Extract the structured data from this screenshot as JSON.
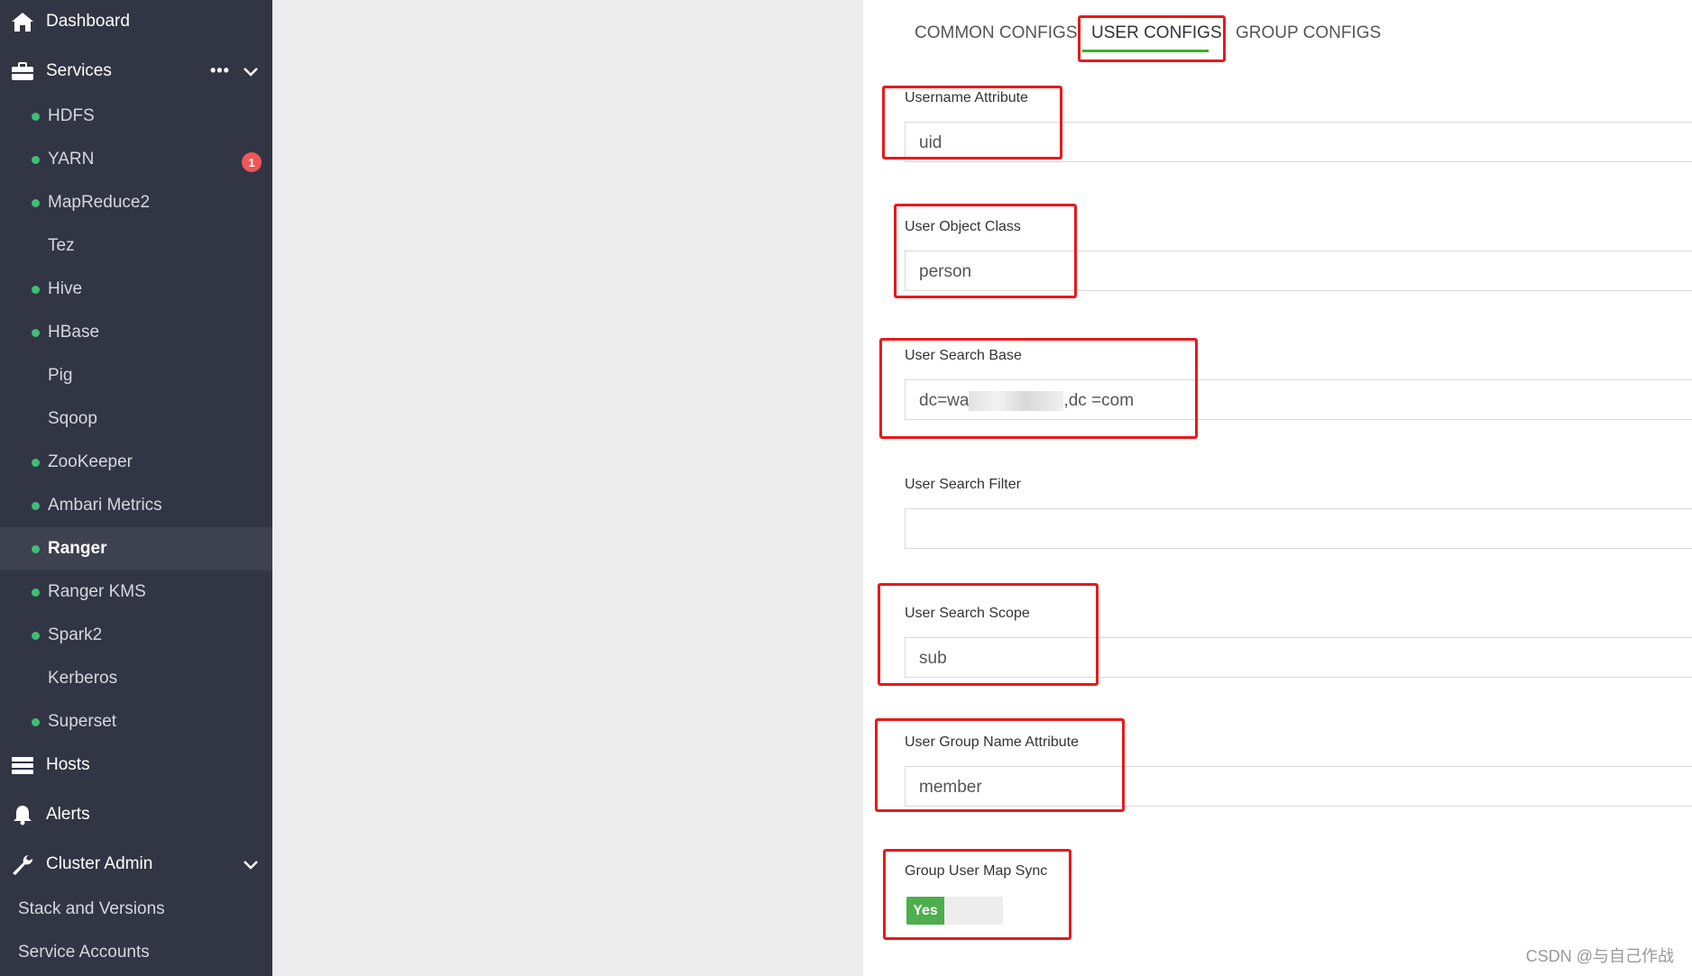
{
  "sidebar": {
    "dashboard_label": "Dashboard",
    "services_label": "Services",
    "services_more": "•••",
    "services": [
      {
        "label": "HDFS",
        "status": "green"
      },
      {
        "label": "YARN",
        "status": "green",
        "badge": "1"
      },
      {
        "label": "MapReduce2",
        "status": "green"
      },
      {
        "label": "Tez",
        "status": "none"
      },
      {
        "label": "Hive",
        "status": "green"
      },
      {
        "label": "HBase",
        "status": "green"
      },
      {
        "label": "Pig",
        "status": "none"
      },
      {
        "label": "Sqoop",
        "status": "none"
      },
      {
        "label": "ZooKeeper",
        "status": "green"
      },
      {
        "label": "Ambari Metrics",
        "status": "green"
      },
      {
        "label": "Ranger",
        "status": "green",
        "active": true
      },
      {
        "label": "Ranger KMS",
        "status": "green"
      },
      {
        "label": "Spark2",
        "status": "green"
      },
      {
        "label": "Kerberos",
        "status": "none"
      },
      {
        "label": "Superset",
        "status": "green"
      }
    ],
    "hosts_label": "Hosts",
    "alerts_label": "Alerts",
    "cluster_admin_label": "Cluster Admin",
    "cluster_admin_items": [
      "Stack and Versions",
      "Service Accounts"
    ],
    "icons": [
      "home-icon",
      "briefcase-icon",
      "server-icon",
      "bell-icon",
      "wrench-icon",
      "chevron-down-icon"
    ]
  },
  "tabs": {
    "common": "COMMON CONFIGS",
    "user": "USER CONFIGS",
    "group": "GROUP CONFIGS",
    "active": "USER CONFIGS"
  },
  "fields": {
    "username_attribute": {
      "label": "Username Attribute",
      "value": "uid"
    },
    "user_object_class": {
      "label": "User Object Class",
      "value": "person"
    },
    "user_search_base": {
      "label": "User Search Base",
      "value_start": "dc=wa",
      "value_end": ",dc =com"
    },
    "user_search_filter": {
      "label": "User Search Filter",
      "value": ""
    },
    "user_search_scope": {
      "label": "User Search Scope",
      "value": "sub"
    },
    "user_group_name_attribute": {
      "label": "User Group Name Attribute",
      "value": "member"
    },
    "group_user_map_sync": {
      "label": "Group User Map Sync",
      "value": "Yes"
    }
  },
  "colors": {
    "sidebar_bg": "#323544",
    "status_green": "#3fbf76",
    "badge_red": "#ee5757",
    "highlight_red": "#e8191b",
    "tab_underline": "#3fae2a",
    "toggle_green": "#4cae4c"
  },
  "watermark": "CSDN @与自己作战"
}
